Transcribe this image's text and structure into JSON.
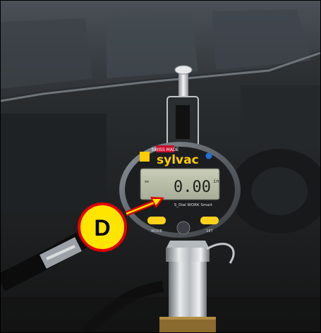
{
  "photo": {
    "subject": "digital-dial-indicator-on-vehicle"
  },
  "indicator": {
    "brand_badge": "SWISS MADE",
    "brand_name": "sylvac",
    "bluetooth_icon": "bluetooth-icon",
    "reading": "0.00",
    "unit": "in",
    "model_label": "S_Dial WORK Smart",
    "left_button_label": "MODE",
    "right_button_label": "SET"
  },
  "callout": {
    "letter": "D",
    "fill_color": "#ffe500",
    "stroke_color": "#e00000",
    "arrow_color": "#e00000"
  }
}
